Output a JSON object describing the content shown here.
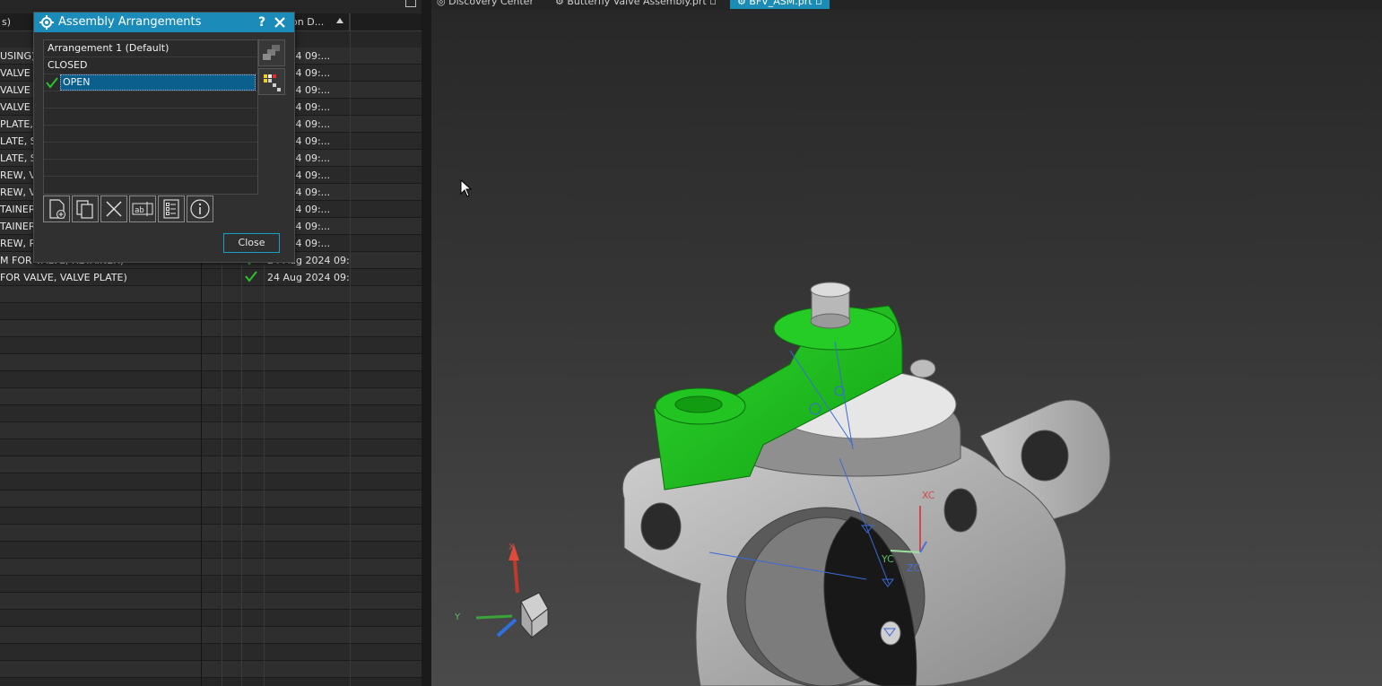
{
  "navigator": {
    "header": {
      "name_col": "s)",
      "date_col": "ion D..."
    },
    "rows": [
      {
        "name": "USING)",
        "date": "g 2024 09:...",
        "checked": false
      },
      {
        "name": "VALVE H",
        "date": "g 2024 09:...",
        "checked": false
      },
      {
        "name": "VALVE H",
        "date": "g 2024 09:...",
        "checked": false
      },
      {
        "name": "VALVE H",
        "date": "g 2024 09:...",
        "checked": false
      },
      {
        "name": "PLATE, S",
        "date": "g 2024 09:...",
        "checked": false
      },
      {
        "name": "LATE, SH",
        "date": "g 2024 09:...",
        "checked": false
      },
      {
        "name": "LATE, SH",
        "date": "g 2024 09:...",
        "checked": false
      },
      {
        "name": "REW, VA",
        "date": "g 2024 09:...",
        "checked": false
      },
      {
        "name": "REW, VA",
        "date": "g 2024 09:...",
        "checked": false
      },
      {
        "name": "TAINER,",
        "date": "g 2024 09:...",
        "checked": false
      },
      {
        "name": "TAINER,",
        "date": "g 2024 09:...",
        "checked": false
      },
      {
        "name": "REW, RE",
        "date": "g 2024 09:...",
        "checked": false
      },
      {
        "name": "M FOR VALVE, RETAINER)",
        "date": "24 Aug 2024 09:...",
        "checked": true
      },
      {
        "name": "FOR VALVE, VALVE PLATE)",
        "date": "24 Aug 2024 09:...",
        "checked": true
      }
    ]
  },
  "tabs": [
    {
      "label": "Discovery Center"
    },
    {
      "label": "Butterfly Valve Assembly.prt"
    },
    {
      "label": "BFV_ASM.prt"
    }
  ],
  "dialog": {
    "title": "Assembly Arrangements",
    "help_label": "?",
    "arrangements": [
      {
        "label": "Arrangement 1 (Default)",
        "active": false
      },
      {
        "label": "CLOSED",
        "active": false
      },
      {
        "label": "OPEN",
        "active": true
      }
    ],
    "close_label": "Close"
  },
  "viewport": {
    "triad": {
      "x": "X",
      "y": "Y"
    },
    "wcs": {
      "xc": "XC",
      "yc": "YC",
      "zc": "ZC"
    }
  },
  "colors": {
    "accent": "#1b8cba",
    "green_part": "#19b319",
    "check": "#2fc02f"
  }
}
